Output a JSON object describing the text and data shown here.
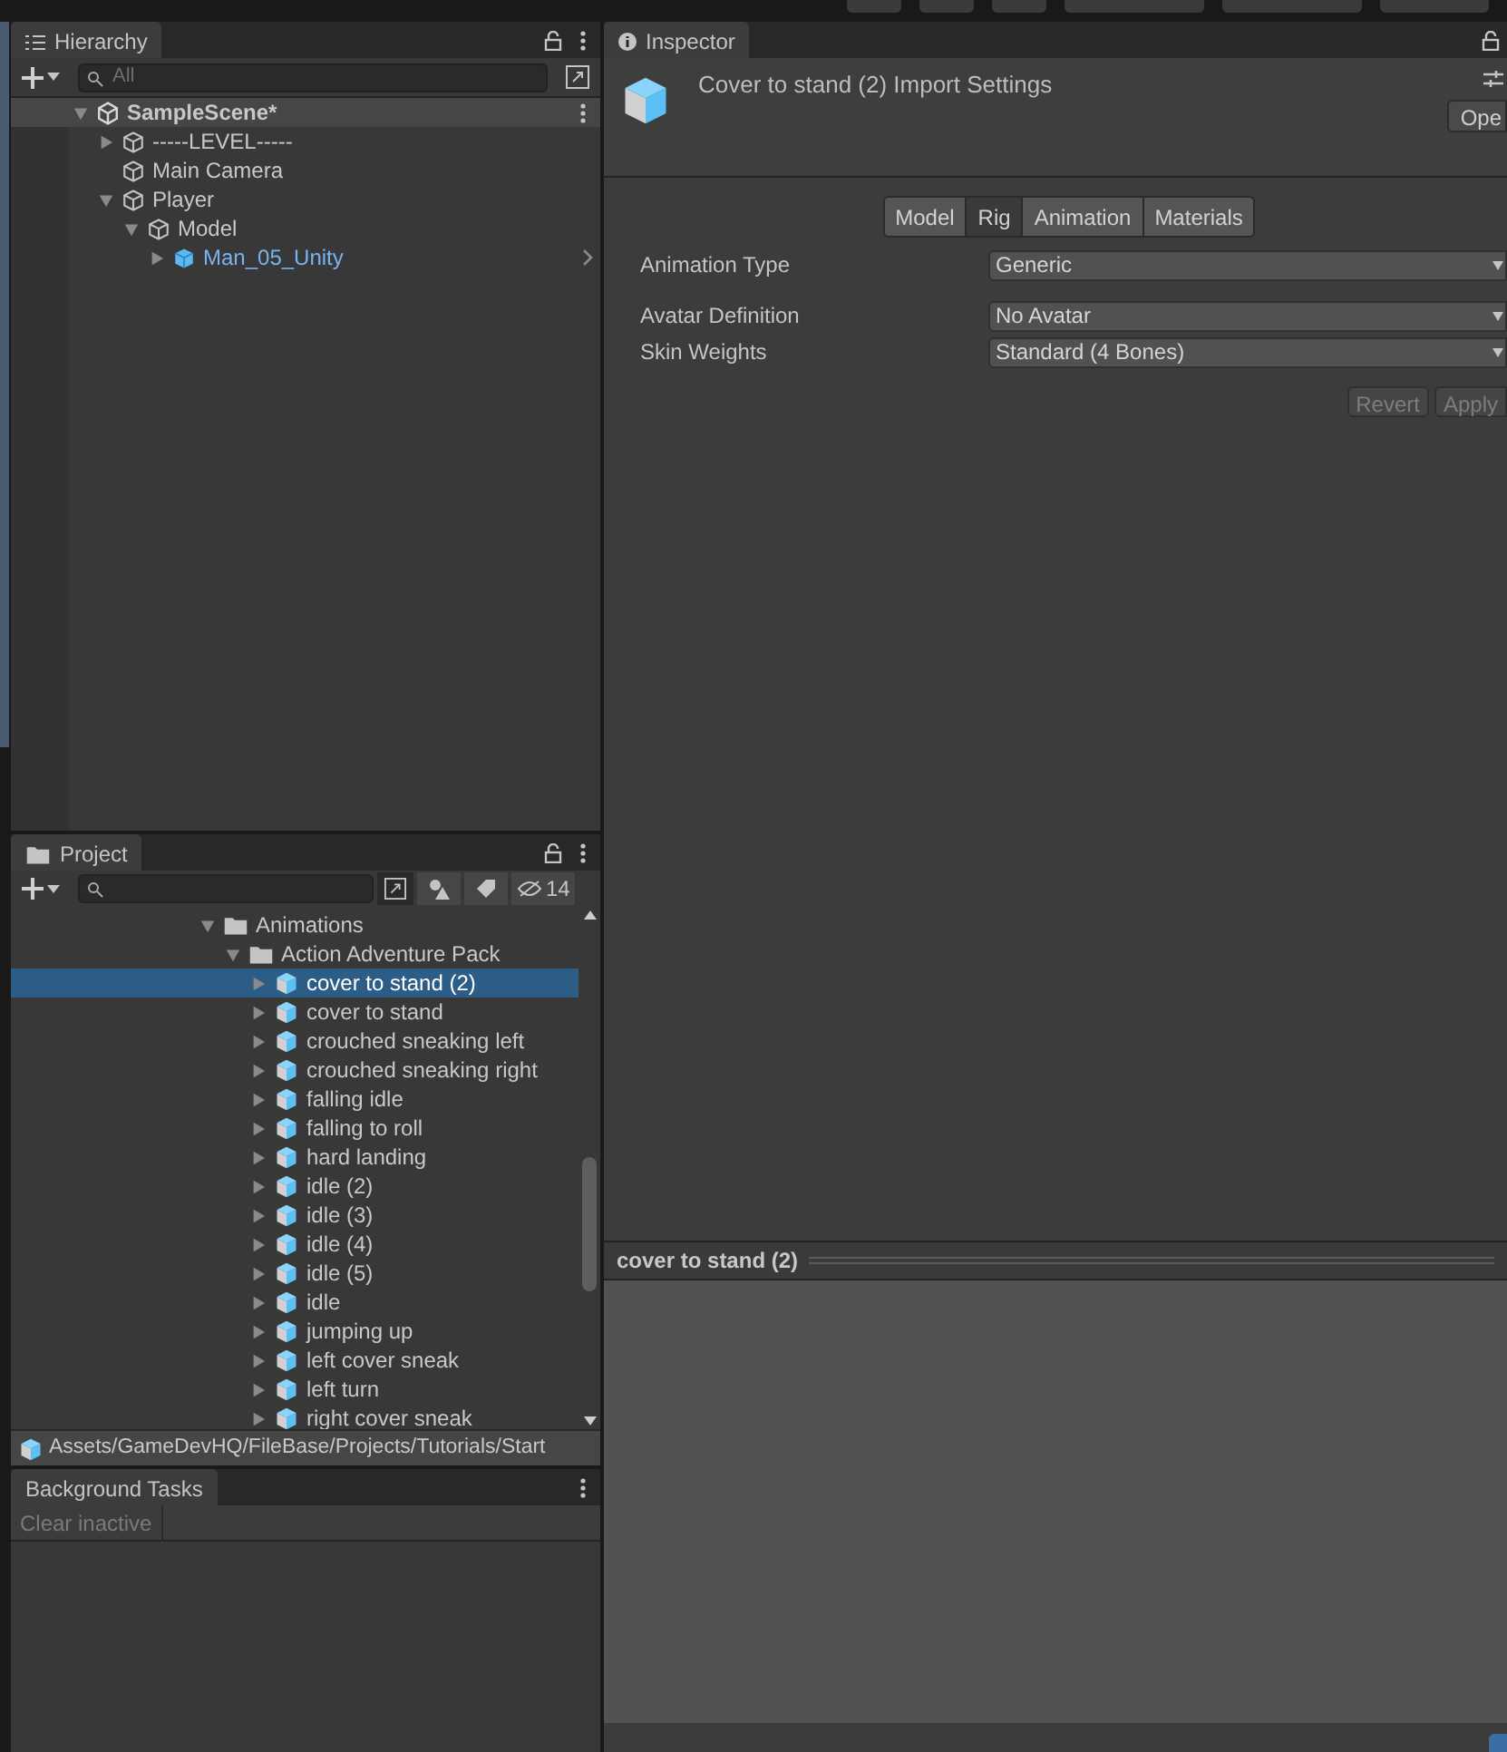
{
  "hierarchy": {
    "title": "Hierarchy",
    "search": {
      "placeholder": "All"
    },
    "tree": [
      {
        "label": "SampleScene*",
        "kind": "scene",
        "expanded": true,
        "children": [
          {
            "label": "-----LEVEL-----",
            "kind": "object",
            "expanded": false
          },
          {
            "label": "Main Camera",
            "kind": "object"
          },
          {
            "label": "Player",
            "kind": "object",
            "expanded": true,
            "children": [
              {
                "label": "Model",
                "kind": "object",
                "expanded": true,
                "children": [
                  {
                    "label": "Man_05_Unity",
                    "kind": "prefab",
                    "expanded": false
                  }
                ]
              }
            ]
          }
        ]
      }
    ]
  },
  "project": {
    "title": "Project",
    "hidden_count": "14",
    "tree": [
      {
        "label": "Animations",
        "kind": "folder",
        "expanded": true,
        "children": [
          {
            "label": "Action Adventure Pack",
            "kind": "folder",
            "expanded": true,
            "children": [
              {
                "label": "cover to stand (2)",
                "kind": "model",
                "expanded": false,
                "selected": true
              },
              {
                "label": "cover to stand",
                "kind": "model",
                "expanded": false,
                "selected": false
              },
              {
                "label": "crouched sneaking left",
                "kind": "model",
                "expanded": false,
                "selected": false
              },
              {
                "label": "crouched sneaking right",
                "kind": "model",
                "expanded": false,
                "selected": false
              },
              {
                "label": "falling idle",
                "kind": "model",
                "expanded": false,
                "selected": false
              },
              {
                "label": "falling to roll",
                "kind": "model",
                "expanded": false,
                "selected": false
              },
              {
                "label": "hard landing",
                "kind": "model",
                "expanded": false,
                "selected": false
              },
              {
                "label": "idle (2)",
                "kind": "model",
                "expanded": false,
                "selected": false
              },
              {
                "label": "idle (3)",
                "kind": "model",
                "expanded": false,
                "selected": false
              },
              {
                "label": "idle (4)",
                "kind": "model",
                "expanded": false,
                "selected": false
              },
              {
                "label": "idle (5)",
                "kind": "model",
                "expanded": false,
                "selected": false
              },
              {
                "label": "idle",
                "kind": "model",
                "expanded": false,
                "selected": false
              },
              {
                "label": "jumping up",
                "kind": "model",
                "expanded": false,
                "selected": false
              },
              {
                "label": "left cover sneak",
                "kind": "model",
                "expanded": false,
                "selected": false
              },
              {
                "label": "left turn",
                "kind": "model",
                "expanded": false,
                "selected": false
              },
              {
                "label": "right cover sneak",
                "kind": "model",
                "expanded": false,
                "selected": false
              }
            ]
          }
        ]
      }
    ],
    "path": "Assets/GameDevHQ/FileBase/Projects/Tutorials/Start"
  },
  "background_tasks": {
    "title": "Background Tasks",
    "clear_button": "Clear inactive"
  },
  "inspector": {
    "title": "Inspector",
    "heading": "Cover to stand (2) Import Settings",
    "open_button": "Ope",
    "tabs": [
      {
        "label": "Model",
        "selected": false
      },
      {
        "label": "Rig",
        "selected": true
      },
      {
        "label": "Animation",
        "selected": false
      },
      {
        "label": "Materials",
        "selected": false
      }
    ],
    "fields": [
      {
        "label": "Animation Type",
        "value": "Generic"
      },
      {
        "label": "Avatar Definition",
        "value": "No Avatar"
      },
      {
        "label": "Skin Weights",
        "value": "Standard (4 Bones)"
      }
    ],
    "buttons": [
      {
        "label": "Revert",
        "disabled": true
      },
      {
        "label": "Apply",
        "disabled": true
      }
    ],
    "preview_title": "cover to stand (2)"
  }
}
